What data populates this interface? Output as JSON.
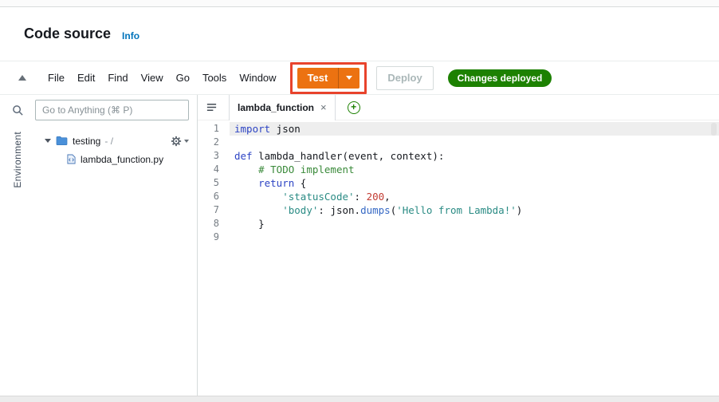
{
  "header": {
    "title": "Code source",
    "info_label": "Info"
  },
  "toolbar": {
    "menus": [
      "File",
      "Edit",
      "Find",
      "View",
      "Go",
      "Tools",
      "Window"
    ],
    "test_label": "Test",
    "deploy_label": "Deploy",
    "status_label": "Changes deployed"
  },
  "sidebar": {
    "search_placeholder": "Go to Anything (⌘ P)",
    "environment_label": "Environment",
    "tree": {
      "folder_name": "testing",
      "folder_suffix": "- /",
      "file_name": "lambda_function.py"
    }
  },
  "editor": {
    "tab_label": "lambda_function",
    "tab_close_glyph": "×",
    "new_tab_glyph": "+",
    "line_count": 9,
    "code_lines": [
      [
        {
          "t": "kw",
          "v": "import"
        },
        {
          "t": "tx",
          "v": " json"
        }
      ],
      [],
      [
        {
          "t": "kw",
          "v": "def"
        },
        {
          "t": "tx",
          "v": " lambda_handler(event, context):"
        }
      ],
      [
        {
          "t": "tx",
          "v": "    "
        },
        {
          "t": "cm",
          "v": "# TODO implement"
        }
      ],
      [
        {
          "t": "tx",
          "v": "    "
        },
        {
          "t": "kw",
          "v": "return"
        },
        {
          "t": "tx",
          "v": " {"
        }
      ],
      [
        {
          "t": "tx",
          "v": "        "
        },
        {
          "t": "st",
          "v": "'statusCode'"
        },
        {
          "t": "tx",
          "v": ": "
        },
        {
          "t": "nu",
          "v": "200"
        },
        {
          "t": "tx",
          "v": ","
        }
      ],
      [
        {
          "t": "tx",
          "v": "        "
        },
        {
          "t": "st",
          "v": "'body'"
        },
        {
          "t": "tx",
          "v": ": json."
        },
        {
          "t": "fn",
          "v": "dumps"
        },
        {
          "t": "tx",
          "v": "("
        },
        {
          "t": "st",
          "v": "'Hello from Lambda!'"
        },
        {
          "t": "tx",
          "v": ")"
        }
      ],
      [
        {
          "t": "tx",
          "v": "    }"
        }
      ],
      []
    ]
  },
  "colors": {
    "accent_orange": "#ec7211",
    "badge_green": "#1d8102",
    "annotation_red": "#e8432c",
    "link_blue": "#0073bb",
    "tok_kw": "#2d44c4",
    "tok_st": "#2a8b84",
    "tok_cm": "#3a8a3a",
    "tok_nu": "#c33c33",
    "tok_fn": "#3568c4",
    "tok_tx": "#16191f"
  }
}
